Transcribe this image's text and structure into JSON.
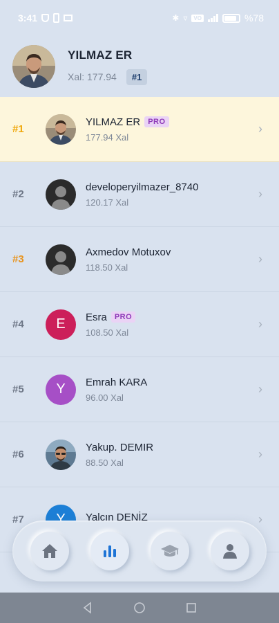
{
  "status_bar": {
    "time": "3:41",
    "battery_text": "%78"
  },
  "profile": {
    "name": "YILMAZ ER",
    "score": "Xal: 177.94",
    "rank": "#1"
  },
  "leaderboard": [
    {
      "rank": "#1",
      "name": "YILMAZ ER",
      "pro": "PRO",
      "score": "177.94 Xal",
      "avatar": "photo"
    },
    {
      "rank": "#2",
      "name": "developeryilmazer_8740",
      "pro": "",
      "score": "120.17 Xal",
      "avatar": "placeholder"
    },
    {
      "rank": "#3",
      "name": "Axmedov Motuxov",
      "pro": "",
      "score": "118.50 Xal",
      "avatar": "placeholder"
    },
    {
      "rank": "#4",
      "name": "Esra",
      "pro": "PRO",
      "score": "108.50 Xal",
      "avatar": "E"
    },
    {
      "rank": "#5",
      "name": "Emrah KARA",
      "pro": "",
      "score": "96.00 Xal",
      "avatar": "Y"
    },
    {
      "rank": "#6",
      "name": "Yakup. DEMIR",
      "pro": "",
      "score": "88.50 Xal",
      "avatar": "photo"
    },
    {
      "rank": "#7",
      "name": "Yalçın DENİZ",
      "pro": "",
      "score": "",
      "avatar": "Y"
    }
  ],
  "bottom_nav": {
    "items": [
      "home-icon",
      "leaderboard-icon",
      "courses-icon",
      "profile-icon"
    ],
    "active": "leaderboard-icon"
  },
  "colors": {
    "background": "#d9e2ef",
    "highlight_row": "#fdf6dc",
    "gold_rank": "#f0a80c",
    "bronze_rank": "#e8931c",
    "pro_badge_bg": "#ead3f5",
    "pro_badge_text": "#8e39b8",
    "avatar_e": "#cc1f5a",
    "avatar_y_purple": "#a64fc6",
    "avatar_y_blue": "#1c7fd6",
    "active_nav_icon": "#1e74d6"
  }
}
